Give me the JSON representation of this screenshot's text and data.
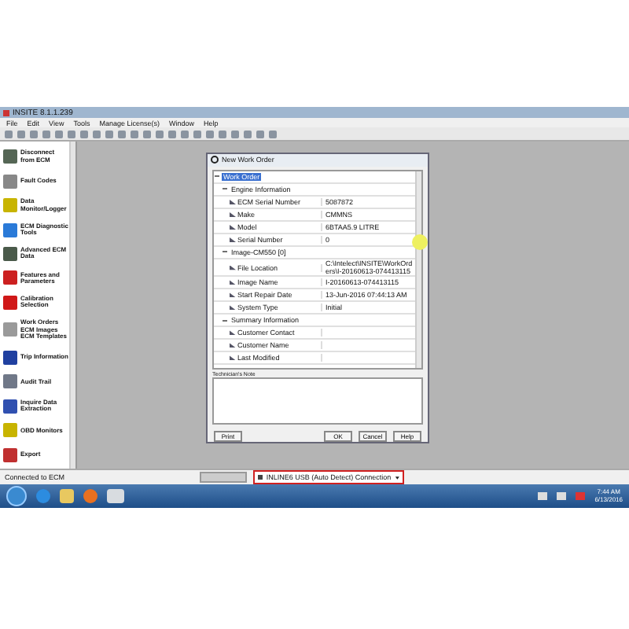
{
  "window": {
    "title": "INSITE 8.1.1.239"
  },
  "menu": [
    "File",
    "Edit",
    "View",
    "Tools",
    "Manage License(s)",
    "Window",
    "Help"
  ],
  "sidebar": {
    "items": [
      {
        "label": "Disconnect from ECM",
        "color": "#556655"
      },
      {
        "label": "Fault Codes",
        "color": "#888888"
      },
      {
        "label": "Data Monitor/Logger",
        "color": "#c8b400"
      },
      {
        "label": "ECM Diagnostic Tools",
        "color": "#2a7ad8"
      },
      {
        "label": "Advanced ECM Data",
        "color": "#4a5a4a"
      },
      {
        "label": "Features and Parameters",
        "color": "#cc2020"
      },
      {
        "label": "Calibration Selection",
        "color": "#d01818"
      },
      {
        "label": "Work Orders ECM Images ECM Templates",
        "color": "#9a9a9a"
      },
      {
        "label": "Trip Information",
        "color": "#2040a0"
      },
      {
        "label": "Audit Trail",
        "color": "#707888"
      },
      {
        "label": "Inquire Data Extraction",
        "color": "#3050b0"
      },
      {
        "label": "OBD Monitors",
        "color": "#c8b400"
      },
      {
        "label": "Export",
        "color": "#c03030"
      }
    ]
  },
  "dialog": {
    "title": "New Work Order",
    "tree": [
      {
        "label": "Work Order",
        "selected": true,
        "expanded": true,
        "children": [
          {
            "label": "Engine Information",
            "selected": false,
            "expanded": true,
            "children": [
              {
                "label": "ECM Serial Number",
                "value": "5087872",
                "selected": false
              },
              {
                "label": "Make",
                "value": "CMMNS",
                "selected": false
              },
              {
                "label": "Model",
                "value": "6BTAA5.9 LITRE",
                "selected": false
              },
              {
                "label": "Serial Number",
                "value": "0",
                "selected": false
              }
            ]
          },
          {
            "label": "Image-CM550 [0]",
            "selected": false,
            "expanded": true,
            "children": [
              {
                "label": "File Location",
                "value": "C:\\Intelect\\INSITE\\WorkOrders\\I-20160613-074413115",
                "selected": false
              },
              {
                "label": "Image Name",
                "value": "I-20160613-074413115",
                "selected": false
              },
              {
                "label": "Start Repair Date",
                "value": "13-Jun-2016 07:44:13 AM",
                "selected": false
              },
              {
                "label": "System Type",
                "value": "Initial",
                "selected": false
              }
            ]
          },
          {
            "label": "Summary Information",
            "selected": false,
            "expanded": true,
            "children": [
              {
                "label": "Customer Contact",
                "selected": false
              },
              {
                "label": "Customer Name",
                "selected": false
              },
              {
                "label": "Last Modified",
                "selected": false
              }
            ]
          }
        ]
      }
    ],
    "note_label": "Technician's Note",
    "buttons": [
      "Print",
      "OK",
      "Cancel",
      "Help"
    ]
  },
  "status_bar": {
    "text": "Connected to ECM",
    "connection": "INLINE6 USB (Auto Detect) Connection"
  },
  "taskbar": {
    "time": "7:44 AM",
    "date": "6/13/2016"
  }
}
